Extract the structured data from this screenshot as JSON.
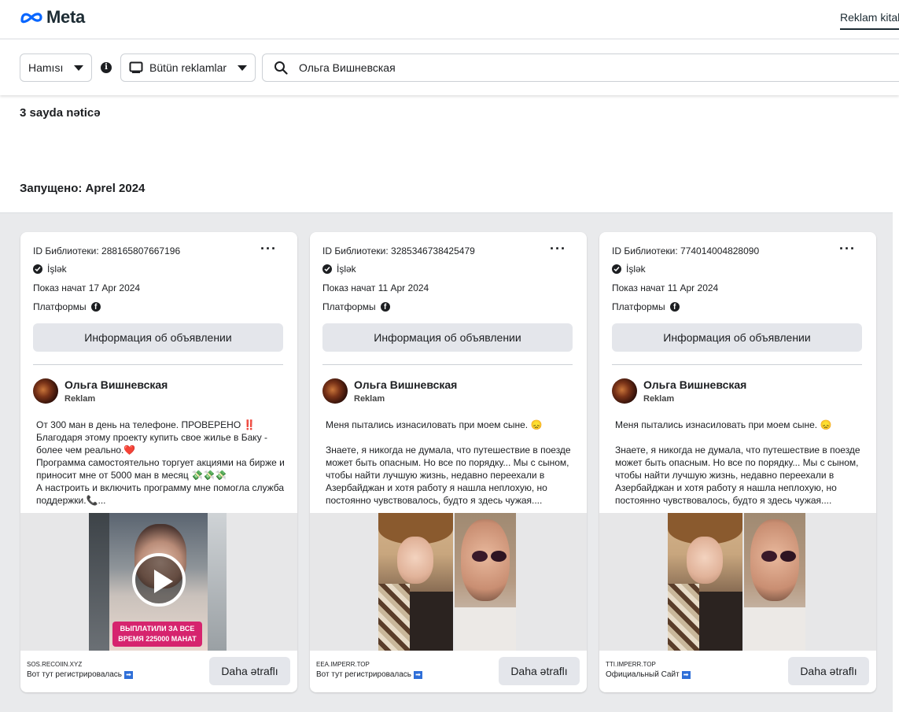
{
  "header": {
    "brand": "Meta",
    "nav_item": "Reklam kitabxanası"
  },
  "filters": {
    "country": "Hamısı",
    "ad_type": "Bütün reklamlar",
    "search_value": "Ольга Вишневская"
  },
  "results_count": "3 sayda nəticə",
  "launched_label": "Запущено: Aprel 2024",
  "cards": [
    {
      "library_id": "ID Библиотеки: 288165807667196",
      "status": "İşlək",
      "start": "Показ начат 17 Apr 2024",
      "platforms": "Платформы",
      "info_button": "Информация об объявлении",
      "advertiser": "Ольга Вишневская",
      "sponsored": "Reklam",
      "text": "От 300 ман в день на телефоне. ПРОВЕРЕНО ‼️\nБлагодаря этому проекту купить свое жилье в Баку - более чем реально.❤️\nПрограмма самостоятельно торгует акциями на бирже и приносит мне от 5000 ман в месяц 💸💸💸\nА настроить и включить программу мне помогла служба поддержки.📞...",
      "media_banner": "ВЫПЛАТИЛИ ЗА ВСЕ ВРЕМЯ 225000 МАНАТ",
      "domain": "SOS.RECOIIN.XYZ",
      "cta_text": "Вот тут регистрировалась",
      "more_button": "Daha ətraflı"
    },
    {
      "library_id": "ID Библиотеки: 3285346738425479",
      "status": "İşlək",
      "start": "Показ начат 11 Apr 2024",
      "platforms": "Платформы",
      "info_button": "Информация об объявлении",
      "advertiser": "Ольга Вишневская",
      "sponsored": "Reklam",
      "text": "Меня пытались изнасиловать при моем сыне. 😞\n\nЗнаете, я никогда не думала, что путешествие в поезде может быть опасным. Но все по порядку... Мы с сыном, чтобы найти лучшую жизнь, недавно переехали в Азербайджан и хотя работу я нашла неплохую, но постоянно чувствовалось, будто я здесь чужая....",
      "domain": "EEA.IMPERR.TOP",
      "cta_text": "Вот тут регистрировалась",
      "more_button": "Daha ətraflı"
    },
    {
      "library_id": "ID Библиотеки: 774014004828090",
      "status": "İşlək",
      "start": "Показ начат 11 Apr 2024",
      "platforms": "Платформы",
      "info_button": "Информация об объявлении",
      "advertiser": "Ольга Вишневская",
      "sponsored": "Reklam",
      "text": "Меня пытались изнасиловать при моем сыне. 😞\n\nЗнаете, я никогда не думала, что путешествие в поезде может быть опасным. Но все по порядку... Мы с сыном, чтобы найти лучшую жизнь, недавно переехали в Азербайджан и хотя работу я нашла неплохую, но постоянно чувствовалось, будто я здесь чужая....",
      "domain": "TTI.IMPERR.TOP",
      "cta_text": "Официальный Сайт",
      "more_button": "Daha ətraflı"
    }
  ]
}
